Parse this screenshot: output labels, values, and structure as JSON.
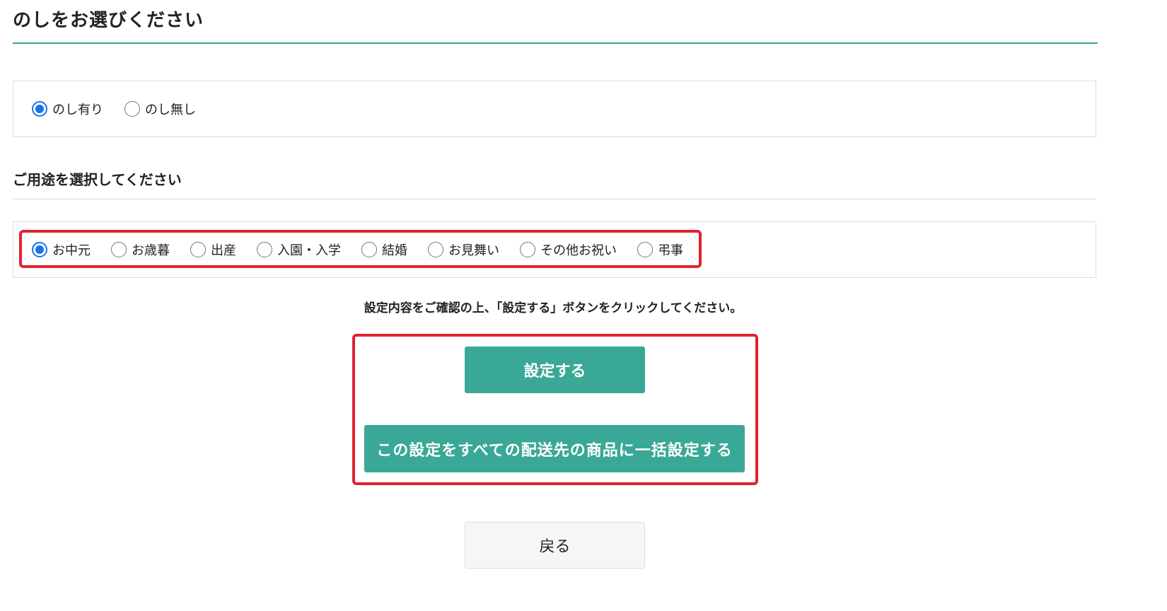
{
  "page": {
    "title": "のしをお選びください"
  },
  "noshi_options": [
    {
      "label": "のし有り",
      "checked": true
    },
    {
      "label": "のし無し",
      "checked": false
    }
  ],
  "purpose_section": {
    "heading": "ご用途を選択してください",
    "options": [
      {
        "label": "お中元",
        "checked": true
      },
      {
        "label": "お歳暮",
        "checked": false
      },
      {
        "label": "出産",
        "checked": false
      },
      {
        "label": "入園・入学",
        "checked": false
      },
      {
        "label": "結婚",
        "checked": false
      },
      {
        "label": "お見舞い",
        "checked": false
      },
      {
        "label": "その他お祝い",
        "checked": false
      },
      {
        "label": "弔事",
        "checked": false
      }
    ]
  },
  "instruction": "設定内容をご確認の上、「設定する」ボタンをクリックしてください。",
  "buttons": {
    "set_label": "設定する",
    "bulk_set_label": "この設定をすべての配送先の商品に一括設定する",
    "back_label": "戻る"
  },
  "colors": {
    "accent": "#3aa896",
    "radio_checked": "#1a73e8",
    "highlight_frame": "#e02230"
  }
}
